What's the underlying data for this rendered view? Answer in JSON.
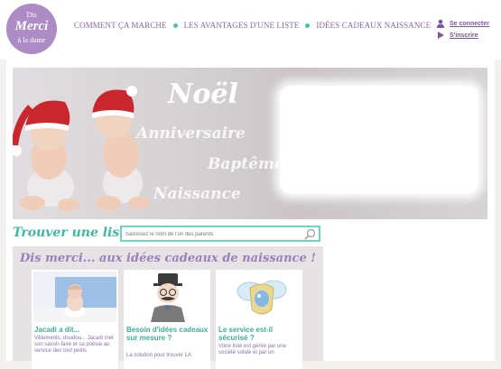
{
  "logo": {
    "line1": "Dis",
    "line2": "Merci",
    "line3": "à la dame"
  },
  "nav": {
    "items": [
      {
        "label": "COMMENT ÇA MARCHE"
      },
      {
        "label": "LES AVANTAGES D'UNE LISTE"
      },
      {
        "label": "IDÉES CADEAUX NAISSANCE"
      }
    ]
  },
  "account": {
    "login_label": "Se connecter",
    "signup_label": "S'inscrire"
  },
  "banner": {
    "words": [
      "Noël",
      "Anniversaire",
      "Baptême",
      "Naissance"
    ]
  },
  "search": {
    "title": "Trouver une liste :",
    "placeholder": "Saisissez le nom de l'un des parents"
  },
  "ideas": {
    "title": "Dis merci... aux idées cadeaux de naissance !",
    "cards": [
      {
        "title": "Jacadi a dit...",
        "text": "Vêtements, doudou... Jacadi met son savoir-faire et sa poésie au service des tout petits"
      },
      {
        "title": "Besoin d'idées cadeaux sur mesure ?",
        "text": "La solution pour trouver LA"
      },
      {
        "title": "Le service est-il sécurisé ?",
        "text": "Votre liste est gérée par une société solide et par un"
      }
    ]
  },
  "colors": {
    "purple": "#8a68a8",
    "teal": "#47c6b0",
    "logo": "#ad8cc6"
  }
}
